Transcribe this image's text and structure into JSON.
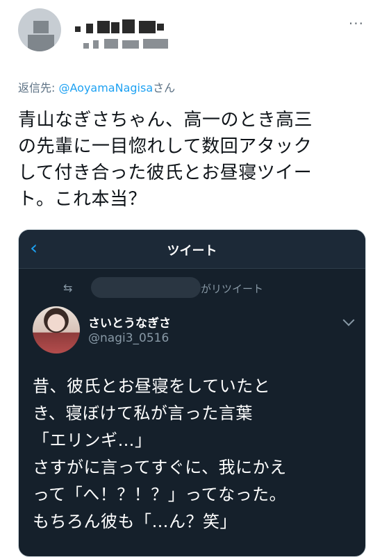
{
  "header": {
    "more_label": "···"
  },
  "reply": {
    "prefix": "返信先: ",
    "handle": "@AoyamaNagisa",
    "suffix": "さん"
  },
  "tweet_lines": [
    "青山なぎさちゃん、高一のとき高三",
    "の先輩に一目惚れして数回アタック",
    "して付き合った彼氏とお昼寝ツイー",
    "ト。これ本当？"
  ],
  "embed": {
    "back_icon": "‹",
    "title": "ツイート",
    "retweet_icon": "⇆",
    "retweet_suffix": "がリツイート",
    "name": "さいとうなぎさ",
    "handle": "@nagi3_0516",
    "lines": [
      "昔、彼氏とお昼寝をしていたと",
      "き、寝ぼけて私が言った言葉",
      "「エリンギ…」",
      "さすがに言ってすぐに、我にかえ",
      "って「へ！？！？」ってなった。",
      "もちろん彼も「…ん？笑」"
    ]
  },
  "colors": {
    "link": "#1da1f2",
    "embed_bg": "#15202b",
    "muted": "#8899a6"
  }
}
